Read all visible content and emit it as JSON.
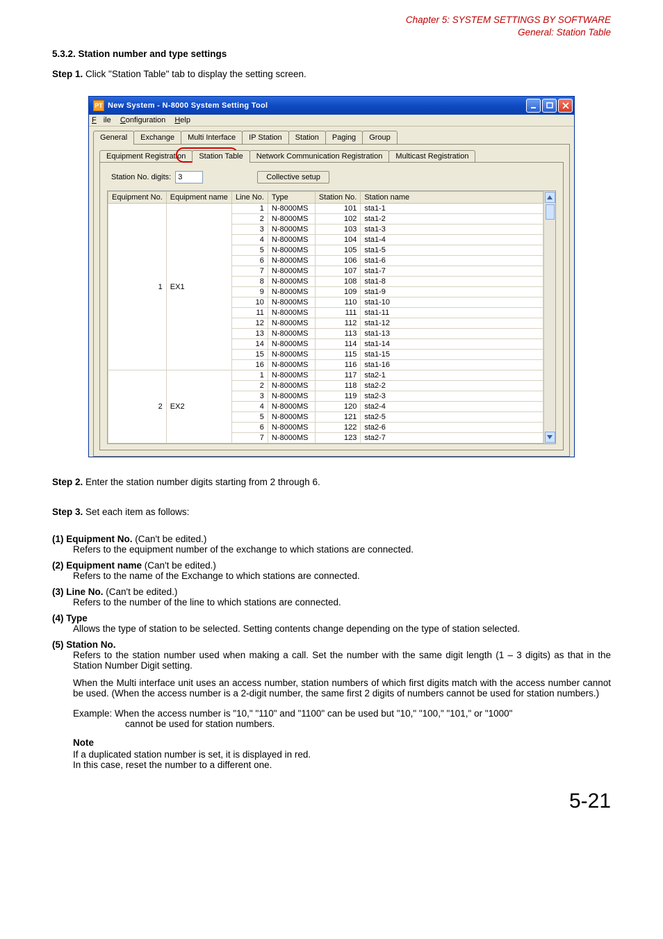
{
  "header": {
    "chapter": "Chapter 5:  SYSTEM SETTINGS BY SOFTWARE",
    "section": "General: Station Table"
  },
  "section_title": "5.3.2. Station number and type settings",
  "step1_label": "Step 1.",
  "step1_text": "Click \"Station Table\" tab to display the setting screen.",
  "window": {
    "title": "New System - N-8000 System Setting Tool",
    "menu": {
      "file": "File",
      "config": "Configuration",
      "help": "Help"
    },
    "tabs": [
      "General",
      "Exchange",
      "Multi Interface",
      "IP Station",
      "Station",
      "Paging",
      "Group"
    ],
    "subtabs": [
      "Equipment Registration",
      "Station Table",
      "Network Communication Registration",
      "Multicast Registration"
    ],
    "station_digits_label": "Station No. digits:",
    "station_digits_value": "3",
    "collective_setup_btn": "Collective setup",
    "columns": [
      "Equipment No.",
      "Equipment name",
      "Line No.",
      "Type",
      "Station No.",
      "Station name"
    ],
    "groups": [
      {
        "eq_no": "1",
        "eq_name": "EX1",
        "rows": [
          {
            "line": "1",
            "type": "N-8000MS",
            "sta_no": "101",
            "sta_name": "sta1-1"
          },
          {
            "line": "2",
            "type": "N-8000MS",
            "sta_no": "102",
            "sta_name": "sta1-2"
          },
          {
            "line": "3",
            "type": "N-8000MS",
            "sta_no": "103",
            "sta_name": "sta1-3"
          },
          {
            "line": "4",
            "type": "N-8000MS",
            "sta_no": "104",
            "sta_name": "sta1-4"
          },
          {
            "line": "5",
            "type": "N-8000MS",
            "sta_no": "105",
            "sta_name": "sta1-5"
          },
          {
            "line": "6",
            "type": "N-8000MS",
            "sta_no": "106",
            "sta_name": "sta1-6"
          },
          {
            "line": "7",
            "type": "N-8000MS",
            "sta_no": "107",
            "sta_name": "sta1-7"
          },
          {
            "line": "8",
            "type": "N-8000MS",
            "sta_no": "108",
            "sta_name": "sta1-8"
          },
          {
            "line": "9",
            "type": "N-8000MS",
            "sta_no": "109",
            "sta_name": "sta1-9"
          },
          {
            "line": "10",
            "type": "N-8000MS",
            "sta_no": "110",
            "sta_name": "sta1-10"
          },
          {
            "line": "11",
            "type": "N-8000MS",
            "sta_no": "111",
            "sta_name": "sta1-11"
          },
          {
            "line": "12",
            "type": "N-8000MS",
            "sta_no": "112",
            "sta_name": "sta1-12"
          },
          {
            "line": "13",
            "type": "N-8000MS",
            "sta_no": "113",
            "sta_name": "sta1-13"
          },
          {
            "line": "14",
            "type": "N-8000MS",
            "sta_no": "114",
            "sta_name": "sta1-14"
          },
          {
            "line": "15",
            "type": "N-8000MS",
            "sta_no": "115",
            "sta_name": "sta1-15"
          },
          {
            "line": "16",
            "type": "N-8000MS",
            "sta_no": "116",
            "sta_name": "sta1-16"
          }
        ]
      },
      {
        "eq_no": "2",
        "eq_name": "EX2",
        "rows": [
          {
            "line": "1",
            "type": "N-8000MS",
            "sta_no": "117",
            "sta_name": "sta2-1"
          },
          {
            "line": "2",
            "type": "N-8000MS",
            "sta_no": "118",
            "sta_name": "sta2-2"
          },
          {
            "line": "3",
            "type": "N-8000MS",
            "sta_no": "119",
            "sta_name": "sta2-3"
          },
          {
            "line": "4",
            "type": "N-8000MS",
            "sta_no": "120",
            "sta_name": "sta2-4"
          },
          {
            "line": "5",
            "type": "N-8000MS",
            "sta_no": "121",
            "sta_name": "sta2-5"
          },
          {
            "line": "6",
            "type": "N-8000MS",
            "sta_no": "122",
            "sta_name": "sta2-6"
          },
          {
            "line": "7",
            "type": "N-8000MS",
            "sta_no": "123",
            "sta_name": "sta2-7"
          }
        ]
      }
    ]
  },
  "step2_label": "Step 2.",
  "step2_text": "Enter the station number digits starting from 2 through 6.",
  "step3_label": "Step 3.",
  "step3_text": "Set each item as follows:",
  "items": [
    {
      "num": "(1)",
      "title": "Equipment No.",
      "note": " (Can't be edited.)",
      "body": "Refers to the equipment number of the exchange to which stations are connected."
    },
    {
      "num": "(2)",
      "title": "Equipment name",
      "note": " (Can't be edited.)",
      "body": "Refers to the name of the Exchange to which stations are connected."
    },
    {
      "num": "(3)",
      "title": "Line No.",
      "note": " (Can't be edited.)",
      "body": "Refers to the number of the line to which stations are connected."
    },
    {
      "num": "(4)",
      "title": "Type",
      "note": "",
      "body": "Allows the type of station to be selected. Setting contents change depending on the type of station selected."
    },
    {
      "num": "(5)",
      "title": "Station No.",
      "note": "",
      "body": "Refers to the station number used when making a call. Set the number with the same digit length (1 – 3 digits) as that in the Station Number Digit setting."
    }
  ],
  "item5_extra": "When the Multi interface unit uses an access number, station numbers of which first digits match with the access number cannot be used. (When the access number is a 2-digit number, the same first 2 digits of numbers cannot be used for station numbers.)",
  "example_l1": "Example: When the access number is \"10,\" \"110\" and \"1100\" can be used but \"10,\" \"100,\" \"101,\" or \"1000\"",
  "example_l2": "cannot be used for station numbers.",
  "note_title": "Note",
  "note_l1": "If a duplicated station number is set, it is displayed in red.",
  "note_l2": "In this case, reset the number to a different one.",
  "page_num": "5-21"
}
